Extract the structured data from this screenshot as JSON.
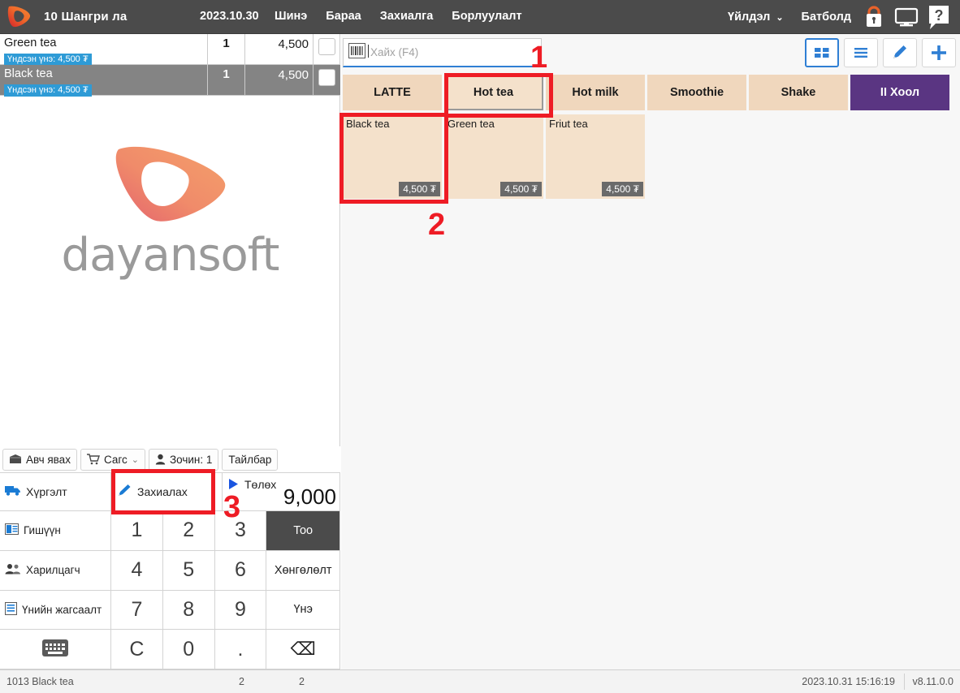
{
  "header": {
    "store_title": "10 Шангри ла",
    "date": "2023.10.30",
    "menu": [
      "Шинэ",
      "Бараа",
      "Захиалга",
      "Борлуулалт"
    ],
    "action_label": "Үйлдэл",
    "user": "Батболд",
    "icons": [
      "lock-icon",
      "monitor-icon",
      "help-icon"
    ]
  },
  "order_list": {
    "rows": [
      {
        "name": "Green tea",
        "sub": "Үндсэн үнэ: 4,500 ₮",
        "qty": "1",
        "price": "4,500",
        "selected": false
      },
      {
        "name": "Black tea",
        "sub": "Үндсэн үнэ: 4,500 ₮",
        "qty": "1",
        "price": "4,500",
        "selected": true
      }
    ]
  },
  "watermark": {
    "text": "dayansoft"
  },
  "chips": [
    {
      "label": "Авч явах",
      "icon": "takeaway-icon"
    },
    {
      "label": "Сагс",
      "icon": "cart-icon",
      "caret": "⌄"
    },
    {
      "label": "Зочин: 1",
      "icon": "person-icon"
    },
    {
      "label": "Тайлбар",
      "icon": "none"
    }
  ],
  "actions": {
    "delivery": "Хүргэлт",
    "order": "Захиалах",
    "pay": "Төлөх",
    "pay_amount": "9,000"
  },
  "keypad_left": [
    {
      "label": "Гишүүн",
      "icon": "member-card-icon"
    },
    {
      "label": "Харилцагч",
      "icon": "customers-icon"
    },
    {
      "label": "Үнийн жагсаалт",
      "icon": "pricelist-icon"
    },
    {
      "label": "",
      "icon": "keyboard-icon"
    }
  ],
  "keypad": {
    "rows": [
      [
        "1",
        "2",
        "3",
        "Тоо"
      ],
      [
        "4",
        "5",
        "6",
        "Хөнгөлөлт"
      ],
      [
        "7",
        "8",
        "9",
        "Үнэ"
      ],
      [
        "C",
        "0",
        ".",
        "⌫"
      ]
    ]
  },
  "search": {
    "placeholder": "Хайх (F4)",
    "icon": "barcode-icon"
  },
  "toolbar": [
    {
      "name": "grid-view-icon",
      "active": true
    },
    {
      "name": "list-view-icon",
      "active": false
    },
    {
      "name": "edit-pencil-icon",
      "active": false
    },
    {
      "name": "plus-add-icon",
      "active": false
    }
  ],
  "categories": [
    {
      "label": "LATTE",
      "style": "normal"
    },
    {
      "label": "Hot tea",
      "style": "selected"
    },
    {
      "label": "Hot milk",
      "style": "normal"
    },
    {
      "label": "Smoothie",
      "style": "normal"
    },
    {
      "label": "Shake",
      "style": "normal"
    },
    {
      "label": "II Хоол",
      "style": "purple"
    }
  ],
  "products": [
    {
      "name": "Black tea",
      "price": "4,500 ₮"
    },
    {
      "name": "Green tea",
      "price": "4,500 ₮"
    },
    {
      "name": "Friut tea",
      "price": "4,500 ₮"
    }
  ],
  "status_bar": {
    "item": "1013 Black tea",
    "num1": "2",
    "num2": "2",
    "timestamp": "2023.10.31 15:16:19",
    "version": "v8.11.0.0"
  },
  "annotations": [
    {
      "number": "1"
    },
    {
      "number": "2"
    },
    {
      "number": "3"
    }
  ],
  "colors": {
    "header_bg": "#4b4b4b",
    "accent_blue": "#2f7fd4",
    "category_bg": "#f0d7bd",
    "category_purple": "#5a3582",
    "annotation_red": "#ee1c25",
    "selected_row": "#848484"
  }
}
